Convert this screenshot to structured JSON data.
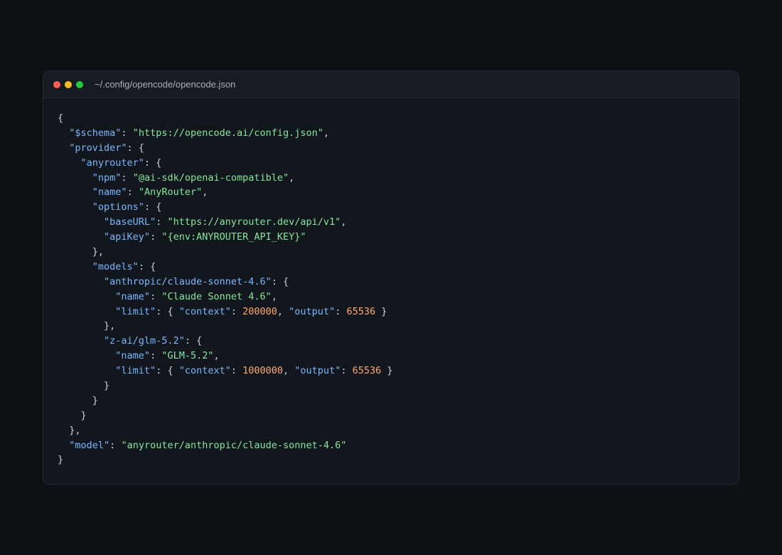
{
  "window": {
    "title": "~/.config/opencode/opencode.json"
  },
  "code": {
    "lines": [
      [
        [
          "p",
          "{"
        ]
      ],
      [
        [
          "p",
          "  "
        ],
        [
          "k",
          "\"$schema\""
        ],
        [
          "p",
          ": "
        ],
        [
          "s",
          "\"https://opencode.ai/config.json\""
        ],
        [
          "p",
          ","
        ]
      ],
      [
        [
          "p",
          "  "
        ],
        [
          "k",
          "\"provider\""
        ],
        [
          "p",
          ": {"
        ]
      ],
      [
        [
          "p",
          "    "
        ],
        [
          "k",
          "\"anyrouter\""
        ],
        [
          "p",
          ": {"
        ]
      ],
      [
        [
          "p",
          "      "
        ],
        [
          "k",
          "\"npm\""
        ],
        [
          "p",
          ": "
        ],
        [
          "s",
          "\"@ai-sdk/openai-compatible\""
        ],
        [
          "p",
          ","
        ]
      ],
      [
        [
          "p",
          "      "
        ],
        [
          "k",
          "\"name\""
        ],
        [
          "p",
          ": "
        ],
        [
          "s",
          "\"AnyRouter\""
        ],
        [
          "p",
          ","
        ]
      ],
      [
        [
          "p",
          "      "
        ],
        [
          "k",
          "\"options\""
        ],
        [
          "p",
          ": {"
        ]
      ],
      [
        [
          "p",
          "        "
        ],
        [
          "k",
          "\"baseURL\""
        ],
        [
          "p",
          ": "
        ],
        [
          "s",
          "\"https://anyrouter.dev/api/v1\""
        ],
        [
          "p",
          ","
        ]
      ],
      [
        [
          "p",
          "        "
        ],
        [
          "k",
          "\"apiKey\""
        ],
        [
          "p",
          ": "
        ],
        [
          "s",
          "\"{env:ANYROUTER_API_KEY}\""
        ]
      ],
      [
        [
          "p",
          "      },"
        ]
      ],
      [
        [
          "p",
          "      "
        ],
        [
          "k",
          "\"models\""
        ],
        [
          "p",
          ": {"
        ]
      ],
      [
        [
          "p",
          "        "
        ],
        [
          "k",
          "\"anthropic/claude-sonnet-4.6\""
        ],
        [
          "p",
          ": {"
        ]
      ],
      [
        [
          "p",
          "          "
        ],
        [
          "k",
          "\"name\""
        ],
        [
          "p",
          ": "
        ],
        [
          "s",
          "\"Claude Sonnet 4.6\""
        ],
        [
          "p",
          ","
        ]
      ],
      [
        [
          "p",
          "          "
        ],
        [
          "k",
          "\"limit\""
        ],
        [
          "p",
          ": { "
        ],
        [
          "k",
          "\"context\""
        ],
        [
          "p",
          ": "
        ],
        [
          "n",
          "200000"
        ],
        [
          "p",
          ", "
        ],
        [
          "k",
          "\"output\""
        ],
        [
          "p",
          ": "
        ],
        [
          "n",
          "65536"
        ],
        [
          "p",
          " }"
        ]
      ],
      [
        [
          "p",
          "        },"
        ]
      ],
      [
        [
          "p",
          "        "
        ],
        [
          "k",
          "\"z-ai/glm-5.2\""
        ],
        [
          "p",
          ": {"
        ]
      ],
      [
        [
          "p",
          "          "
        ],
        [
          "k",
          "\"name\""
        ],
        [
          "p",
          ": "
        ],
        [
          "s",
          "\"GLM-5.2\""
        ],
        [
          "p",
          ","
        ]
      ],
      [
        [
          "p",
          "          "
        ],
        [
          "k",
          "\"limit\""
        ],
        [
          "p",
          ": { "
        ],
        [
          "k",
          "\"context\""
        ],
        [
          "p",
          ": "
        ],
        [
          "n",
          "1000000"
        ],
        [
          "p",
          ", "
        ],
        [
          "k",
          "\"output\""
        ],
        [
          "p",
          ": "
        ],
        [
          "n",
          "65536"
        ],
        [
          "p",
          " }"
        ]
      ],
      [
        [
          "p",
          "        }"
        ]
      ],
      [
        [
          "p",
          "      }"
        ]
      ],
      [
        [
          "p",
          "    }"
        ]
      ],
      [
        [
          "p",
          "  },"
        ]
      ],
      [
        [
          "p",
          "  "
        ],
        [
          "k",
          "\"model\""
        ],
        [
          "p",
          ": "
        ],
        [
          "s",
          "\"anyrouter/anthropic/claude-sonnet-4.6\""
        ]
      ],
      [
        [
          "p",
          "}"
        ]
      ]
    ]
  },
  "colors": {
    "key": "#79b8ff",
    "string": "#85e89d",
    "number": "#ffab70",
    "punctuation": "#c9d1d9",
    "background": "#12161d",
    "titlebar": "#171b22"
  }
}
